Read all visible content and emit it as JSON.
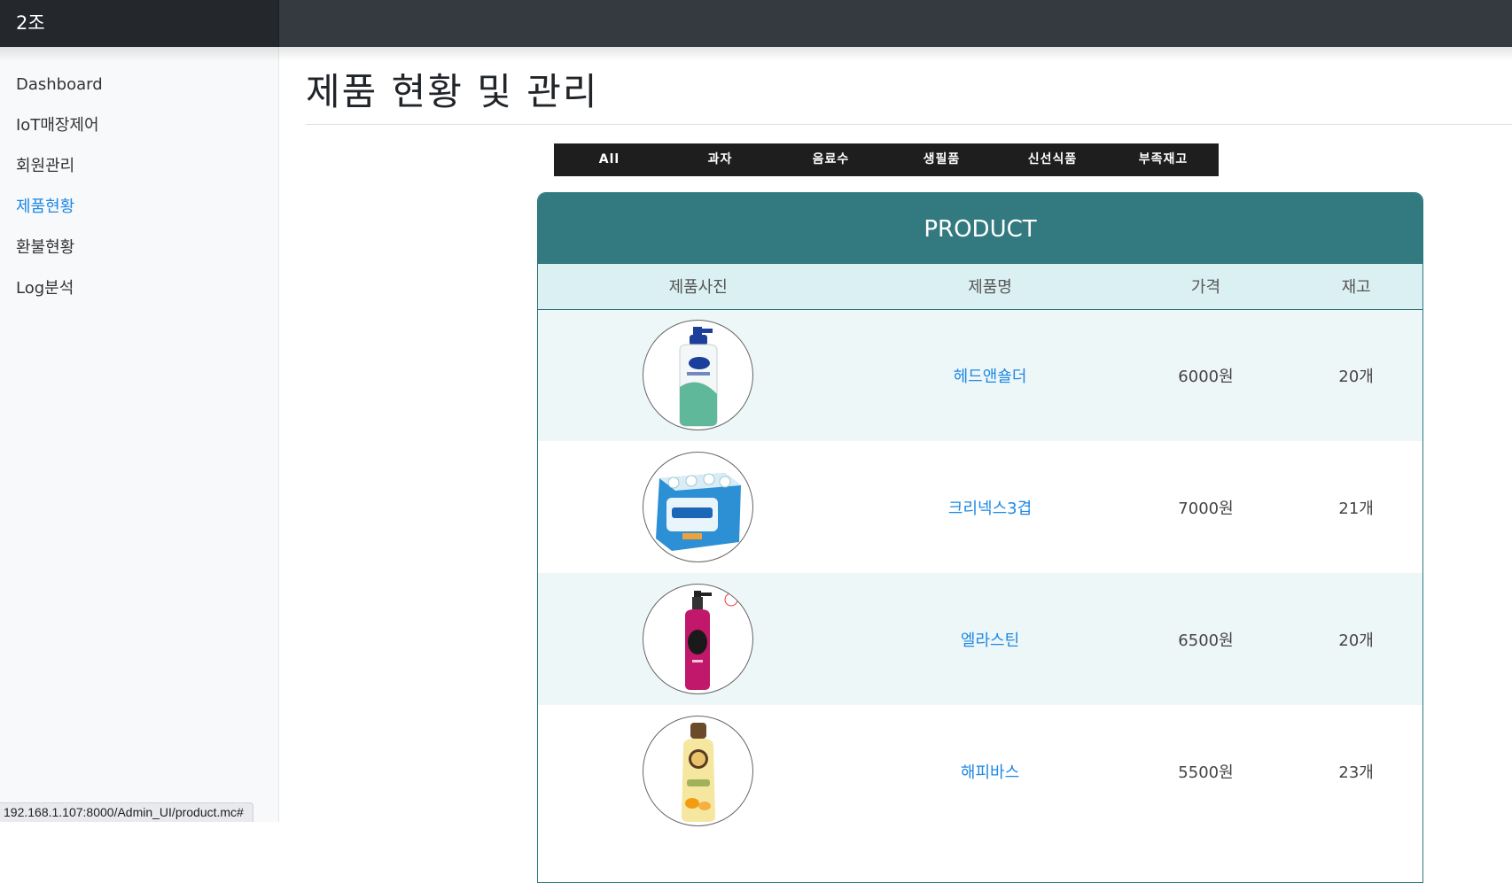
{
  "brand": "2조",
  "sidebar": {
    "items": [
      {
        "label": "Dashboard"
      },
      {
        "label": "IoT매장제어"
      },
      {
        "label": "회원관리"
      },
      {
        "label": "제품현황"
      },
      {
        "label": "환불현황"
      },
      {
        "label": "Log분석"
      }
    ],
    "active": "제품현황"
  },
  "page": {
    "title": "제품 현황 및 관리"
  },
  "tabs": [
    "All",
    "과자",
    "음료수",
    "생필품",
    "신선식품",
    "부족재고"
  ],
  "product_table": {
    "title": "PRODUCT",
    "headers": {
      "photo": "제품사진",
      "name": "제품명",
      "price": "가격",
      "stock": "재고"
    },
    "rows": [
      {
        "icon": "shampoo-bottle-icon",
        "name": "헤드앤숄더",
        "price": "6000원",
        "stock": "20개"
      },
      {
        "icon": "tissue-pack-icon",
        "name": "크리넥스3겹",
        "price": "7000원",
        "stock": "21개"
      },
      {
        "icon": "pink-pump-bottle-icon",
        "name": "엘라스틴",
        "price": "6500원",
        "stock": "20개"
      },
      {
        "icon": "yellow-body-wash-icon",
        "name": "해피바스",
        "price": "5500원",
        "stock": "23개"
      }
    ]
  },
  "status_bar": {
    "url": "192.168.1.107:8000/Admin_UI/product.mc#"
  },
  "colors": {
    "topbar": "#343a40",
    "card_header": "#337a80",
    "link": "#1e88e5",
    "table_header_bg": "#dbf0f2"
  }
}
